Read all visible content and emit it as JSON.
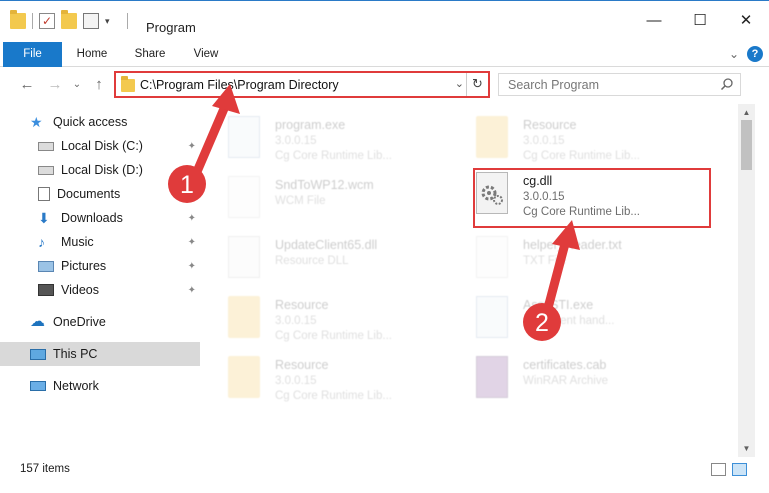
{
  "window": {
    "title": "Program",
    "controls": {
      "minimize": "—",
      "maximize": "☐",
      "close": "✕"
    }
  },
  "ribbon": {
    "tabs": [
      "File",
      "Home",
      "Share",
      "View"
    ],
    "expand_glyph": "⌄",
    "help_glyph": "?"
  },
  "nav": {
    "back": "←",
    "forward": "→",
    "recent": "⌄",
    "up": "↑",
    "address": "C:\\Program Files\\Program Directory",
    "address_dropdown": "⌄",
    "refresh": "↻",
    "search_placeholder": "Search Program"
  },
  "sidebar": {
    "items": [
      {
        "label": "Quick access",
        "icon": "star-icon",
        "pinned": false
      },
      {
        "label": "Local Disk (C:)",
        "icon": "drive-icon",
        "pinned": true
      },
      {
        "label": "Local Disk (D:)",
        "icon": "drive-icon",
        "pinned": true
      },
      {
        "label": "Documents",
        "icon": "document-icon",
        "pinned": true
      },
      {
        "label": "Downloads",
        "icon": "download-icon",
        "pinned": true
      },
      {
        "label": "Music",
        "icon": "music-icon",
        "pinned": true
      },
      {
        "label": "Pictures",
        "icon": "pictures-icon",
        "pinned": true
      },
      {
        "label": "Videos",
        "icon": "video-icon",
        "pinned": true
      },
      {
        "label": "OneDrive",
        "icon": "cloud-icon",
        "pinned": false
      },
      {
        "label": "This PC",
        "icon": "computer-icon",
        "pinned": false,
        "selected": true
      },
      {
        "label": "Network",
        "icon": "network-icon",
        "pinned": false
      }
    ],
    "pin_glyph": "📌"
  },
  "files": [
    {
      "name": "program.exe",
      "line1": "3.0.0.15",
      "line2": "Cg Core Runtime Lib...",
      "icon": "application-icon",
      "faded": true
    },
    {
      "name": "Resource",
      "line1": "3.0.0.15",
      "line2": "Cg Core Runtime Lib...",
      "icon": "folder-icon",
      "faded": true
    },
    {
      "name": "SndToWP12.wcm",
      "line1": "WCM File",
      "line2": "",
      "icon": "document-icon",
      "faded": true
    },
    {
      "name": "cg.dll",
      "line1": "3.0.0.15",
      "line2": "Cg Core Runtime Lib...",
      "icon": "dll-gear-icon",
      "faded": false
    },
    {
      "name": "UpdateClient65.dll",
      "line1": "Resource DLL",
      "line2": "",
      "icon": "dll-gear-icon",
      "faded": true
    },
    {
      "name": "helper_Reader.txt",
      "line1": "TXT File",
      "line2": "",
      "icon": "document-icon",
      "faded": true
    },
    {
      "name": "Resource",
      "line1": "3.0.0.15",
      "line2": "Cg Core Runtime Lib...",
      "icon": "folder-icon",
      "faded": true
    },
    {
      "name": "AssySTI.exe",
      "line1": "...ult event hand...",
      "line2": "",
      "icon": "application-icon",
      "faded": true
    },
    {
      "name": "Resource",
      "line1": "3.0.0.15",
      "line2": "Cg Core Runtime Lib...",
      "icon": "folder-icon",
      "faded": true
    },
    {
      "name": "certificates.cab",
      "line1": "WinRAR Archive",
      "line2": "",
      "icon": "archive-icon",
      "faded": true
    }
  ],
  "status": {
    "item_count": "157 items"
  },
  "annotations": {
    "step1": "1",
    "step2": "2",
    "color": "#e03b3b"
  },
  "colors": {
    "accent": "#1979ca",
    "highlight": "#e03b3b",
    "selected_bg": "#d9d9d9"
  }
}
